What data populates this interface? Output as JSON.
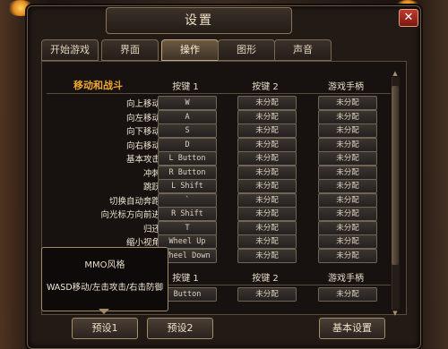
{
  "window": {
    "title": "设置",
    "close_label": "✕"
  },
  "tabs": [
    "开始游戏",
    "界面",
    "操作",
    "图形",
    "声音"
  ],
  "active_tab_index": 2,
  "section1": {
    "title": "移动和战斗",
    "columns": [
      "按键 1",
      "按键 2",
      "游戏手柄"
    ],
    "rows": [
      {
        "label": "向上移动",
        "key1": "W",
        "key2": "未分配",
        "pad": "未分配"
      },
      {
        "label": "向左移动",
        "key1": "A",
        "key2": "未分配",
        "pad": "未分配"
      },
      {
        "label": "向下移动",
        "key1": "S",
        "key2": "未分配",
        "pad": "未分配"
      },
      {
        "label": "向右移动",
        "key1": "D",
        "key2": "未分配",
        "pad": "未分配"
      },
      {
        "label": "基本攻击",
        "key1": "L Button",
        "key2": "未分配",
        "pad": "未分配"
      },
      {
        "label": "冲刺",
        "key1": "R Button",
        "key2": "未分配",
        "pad": "未分配"
      },
      {
        "label": "跳跃",
        "key1": "L Shift",
        "key2": "未分配",
        "pad": "未分配"
      },
      {
        "label": "切换自动奔跑",
        "key1": "`",
        "key2": "未分配",
        "pad": "未分配"
      },
      {
        "label": "向光标方向前进",
        "key1": "R Shift",
        "key2": "未分配",
        "pad": "未分配"
      },
      {
        "label": "归还",
        "key1": "T",
        "key2": "未分配",
        "pad": "未分配"
      },
      {
        "label": "缩小视角",
        "key1": "Wheel Up",
        "key2": "未分配",
        "pad": "未分配"
      },
      {
        "label": "",
        "key1": "Wheel Down",
        "key2": "未分配",
        "pad": "未分配"
      }
    ]
  },
  "section2": {
    "columns": [
      "按键 1",
      "按键 2",
      "游戏手柄"
    ],
    "rows": [
      {
        "label": "",
        "key1": "Button",
        "key2": "未分配",
        "pad": "未分配"
      }
    ]
  },
  "tooltip": {
    "title": "MMO风格",
    "description": "WASD移动/左击攻击/右击防御"
  },
  "bottom_buttons": {
    "preset1": "预设1",
    "preset2": "预设2",
    "basic": "基本设置"
  },
  "colors": {
    "section_title": "#f0a830",
    "active_tab": "#6b5a43",
    "close": "#c23a30"
  }
}
